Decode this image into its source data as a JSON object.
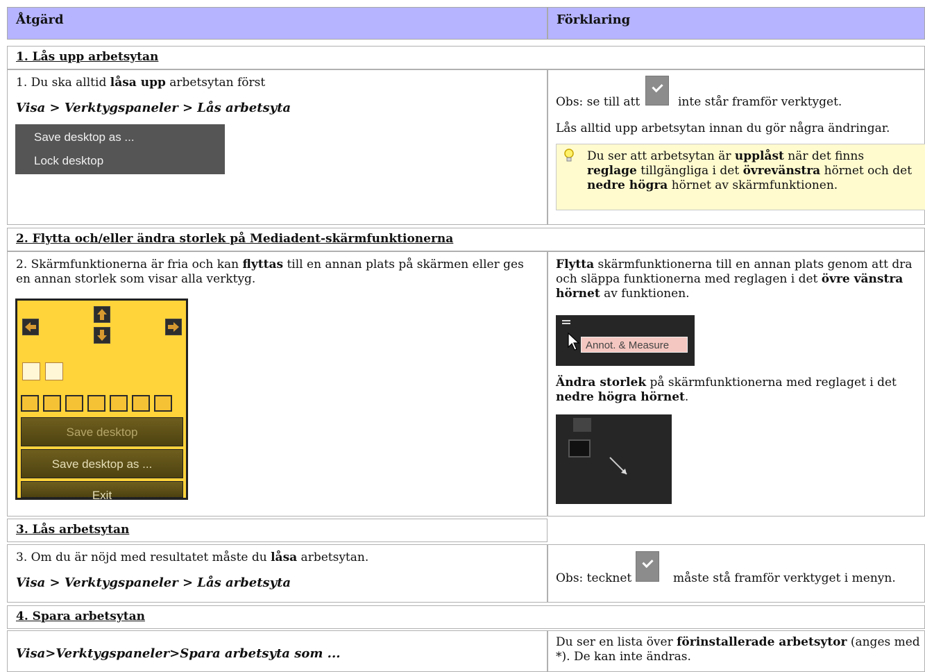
{
  "header": {
    "col1": "Åtgärd",
    "col2": "Förklaring"
  },
  "section1": {
    "title": "1. Lås upp arbetsytan",
    "left": {
      "line_pre": "1. Du ska alltid ",
      "line_bold": "låsa upp",
      "line_post": " arbetsytan först",
      "path": "Visa > Verktygspaneler > Lås arbetsyta",
      "menu_items": [
        "Save desktop as ...",
        "Lock desktop"
      ]
    },
    "right": {
      "obs_pre": "Obs: se till att",
      "obs_post": "inte står framför verktyget.",
      "line2": "Lås alltid upp arbetsytan innan du gör några ändringar.",
      "tip_1": "Du ser att arbetsytan är ",
      "tip_b1": "upplåst",
      "tip_2": " när det finns ",
      "tip_b2": "reglage",
      "tip_3": " tillgängliga i det ",
      "tip_b3": "övrevänstra",
      "tip_4": " hörnet och det ",
      "tip_b4": "nedre högra",
      "tip_5": " hörnet av skärmfunktionen."
    }
  },
  "section2": {
    "title": "2. Flytta och/eller ändra storlek på Mediadent-skärmfunktionerna",
    "left": {
      "t1": "2. Skärmfunktionerna är fria och kan ",
      "b1": "flyttas",
      "t2": " till en annan plats på skärmen eller ges en annan storlek som visar alla verktyg.",
      "buttons": [
        "Save desktop",
        "Save desktop as ...",
        "Exit"
      ]
    },
    "right": {
      "b1": "Flytta",
      "t1": " skärmfunktionerna till en annan plats genom att dra och släppa funktionerna med reglagen i det ",
      "b2": "övre vänstra hörnet",
      "t2": " av funktionen.",
      "annot_label": "Annot. & Measure",
      "b3": "Ändra storlek",
      "t3": " på skärmfunktionerna med reglaget i det ",
      "b4": "nedre högra hörnet",
      "t4": "."
    }
  },
  "section3": {
    "title": "3. Lås arbetsytan",
    "left": {
      "t1": "3. Om du är nöjd med resultatet måste du ",
      "b1": "låsa",
      "t2": " arbetsytan.",
      "path": "Visa > Verktygspaneler > Lås arbetsyta"
    },
    "right": {
      "obs_pre": "Obs: tecknet",
      "obs_post": "måste stå framför verktyget i menyn."
    }
  },
  "section4": {
    "title": "4. Spara arbetsytan",
    "left": {
      "path": "Visa>Verktygspaneler>Spara arbetsyta som ..."
    },
    "right": {
      "t1": "Du ser en lista över ",
      "b1": "förinstallerade arbetsytor",
      "t2": " (anges med *). De kan inte ändras."
    }
  }
}
